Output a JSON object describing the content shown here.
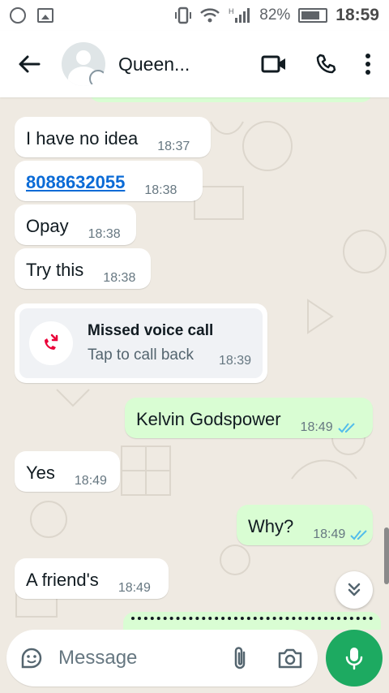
{
  "status_bar": {
    "battery": "82%",
    "time": "18:59"
  },
  "header": {
    "contact_name": "Queen...",
    "icons": [
      "back-arrow-icon",
      "avatar",
      "video-call-icon",
      "voice-call-icon",
      "more-options-icon"
    ]
  },
  "messages": [
    {
      "direction": "in",
      "text": "I have no idea",
      "time": "18:37"
    },
    {
      "direction": "in",
      "text": "8088632055",
      "time": "18:38",
      "is_link": true
    },
    {
      "direction": "in",
      "text": "Opay",
      "time": "18:38"
    },
    {
      "direction": "in",
      "text": "Try this",
      "time": "18:38"
    },
    {
      "direction": "out",
      "text": "Kelvin Godspower",
      "time": "18:49",
      "status": "read"
    },
    {
      "direction": "in",
      "text": "Yes",
      "time": "18:49"
    },
    {
      "direction": "out",
      "text": "Why?",
      "time": "18:49",
      "status": "read"
    },
    {
      "direction": "in",
      "text": "A friend's",
      "time": "18:49"
    }
  ],
  "missed_call": {
    "title": "Missed voice call",
    "subtitle": "Tap to call back",
    "time": "18:39"
  },
  "composer": {
    "placeholder": "Message"
  },
  "colors": {
    "outgoing_bubble": "#d9fdd3",
    "incoming_bubble": "#ffffff",
    "chat_background": "#efeae2",
    "mic_button": "#1daa61",
    "read_ticks": "#53bdeb",
    "missed_call_red": "#ea0038",
    "link": "#0b6bd6"
  }
}
